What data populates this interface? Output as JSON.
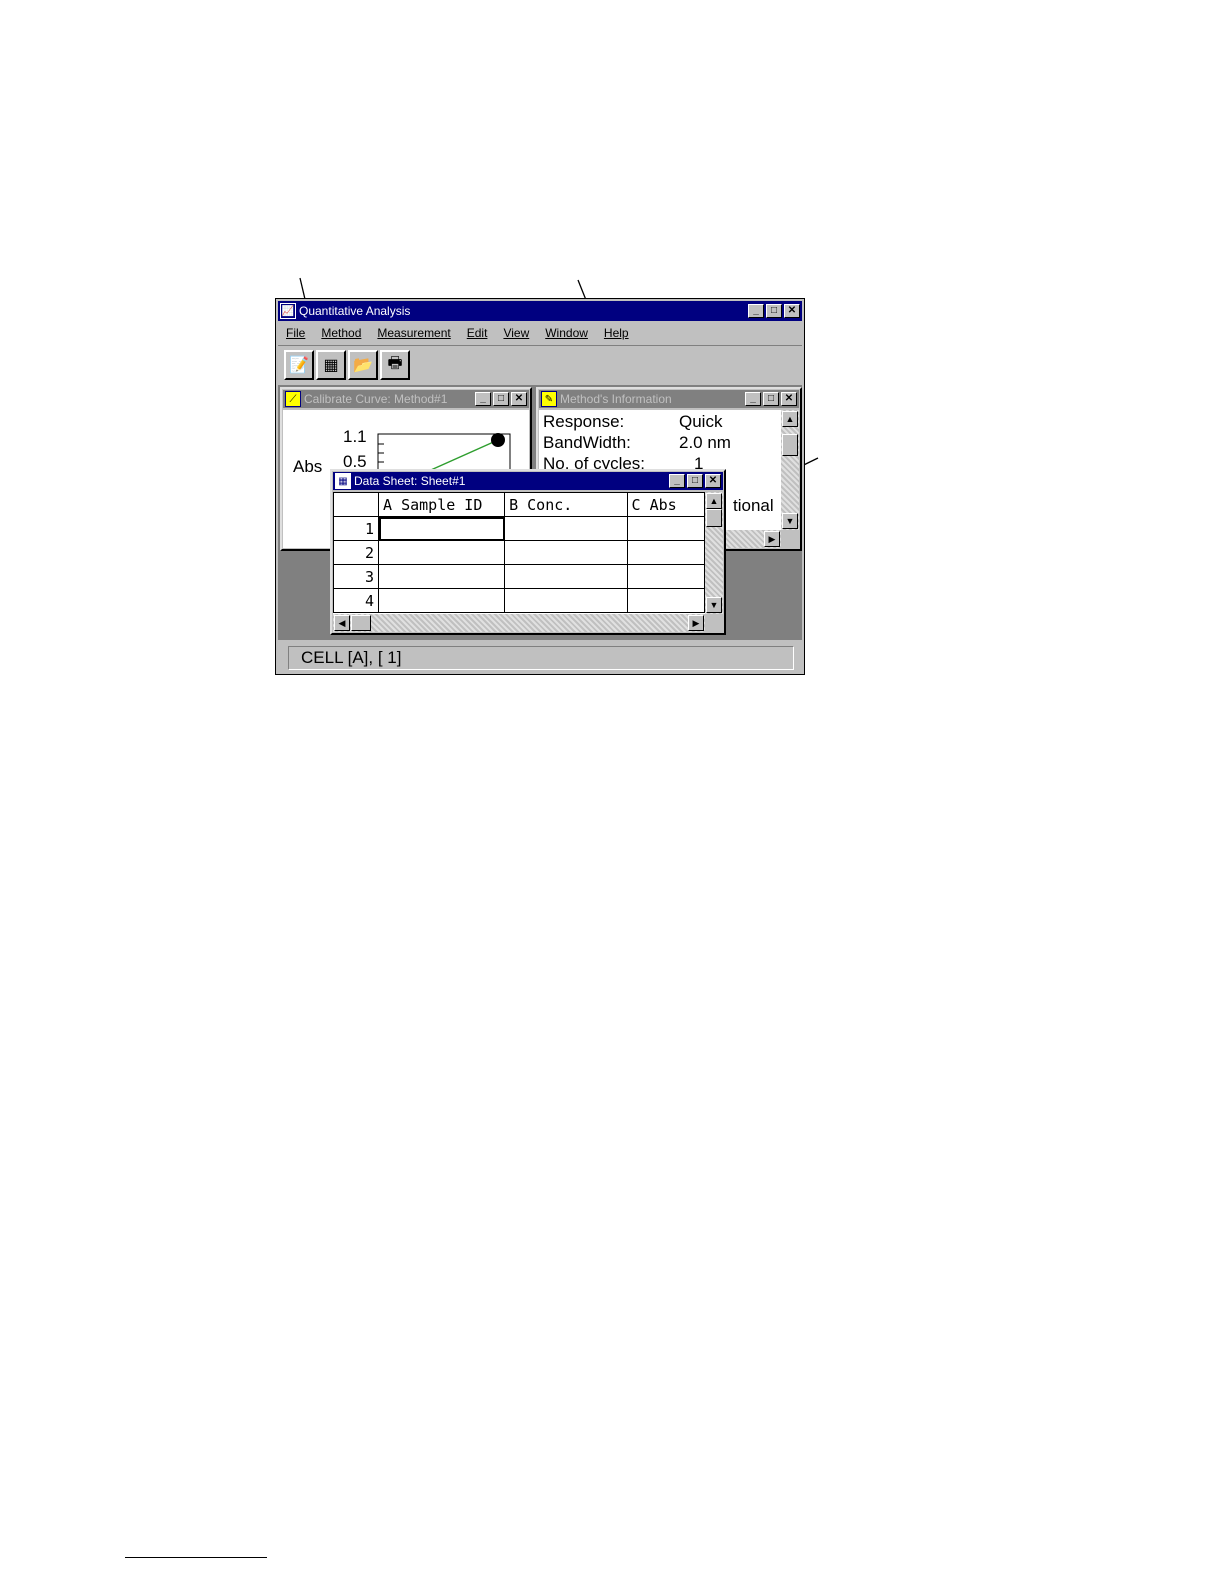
{
  "app": {
    "title": "Quantitative Analysis",
    "menu": [
      "File",
      "Method",
      "Measurement",
      "Edit",
      "View",
      "Window",
      "Help"
    ],
    "toolbar_icons": [
      "method-icon",
      "datasheet-icon",
      "open-folder-icon",
      "printer-icon"
    ],
    "status_text": "CELL  [A], [  1]"
  },
  "window_controls": {
    "minimize": "_",
    "maximize": "□",
    "close": "✕"
  },
  "calib": {
    "title": "Calibrate Curve: Method#1",
    "ylabel": "Abs",
    "tick_top": "1.1",
    "tick_mid": "0.5"
  },
  "method_info": {
    "title": "Method's Information",
    "rows": [
      {
        "label": "Response:",
        "value": "Quick"
      },
      {
        "label": "BandWidth:",
        "value": "2.0 nm"
      },
      {
        "label": "No. of cycles:",
        "value": "1"
      }
    ],
    "partial_text": "tional"
  },
  "datasheet": {
    "title": "Data Sheet: Sheet#1",
    "columns": [
      "A Sample ID",
      "B Conc.",
      "C Abs"
    ],
    "rows": [
      "1",
      "2",
      "3",
      "4"
    ]
  },
  "chart_data": {
    "type": "line",
    "ylabel": "Abs",
    "y_ticks": [
      "1.1",
      "0.5"
    ],
    "points": [
      {
        "x": 1,
        "y": 1.1
      }
    ]
  }
}
